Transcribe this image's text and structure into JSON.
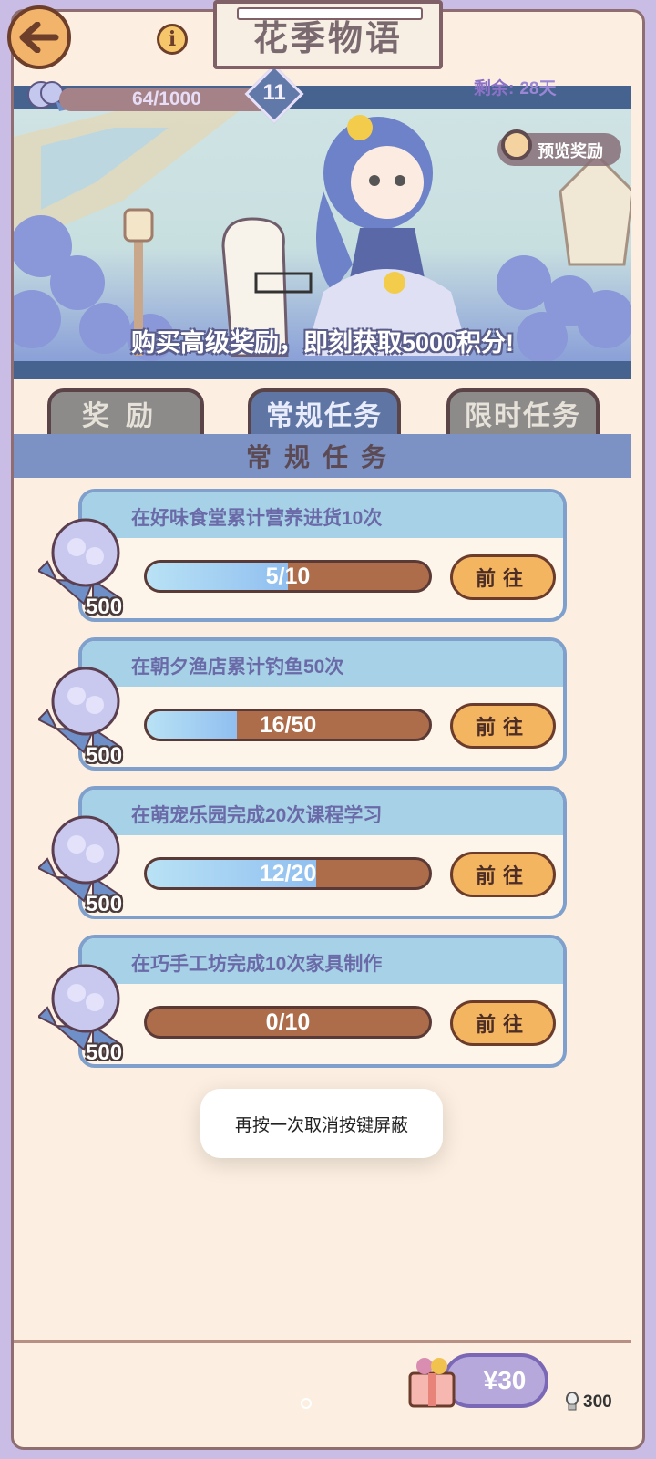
{
  "header": {
    "title": "花季物语",
    "points": "64/1000",
    "level": "11",
    "remaining_label": "剩余:",
    "remaining_value": "28天",
    "preview_label": "预览奖励",
    "promo_text": "购买高级奖励，即刻获取5000积分!"
  },
  "tabs": [
    {
      "label": "奖励",
      "active": false
    },
    {
      "label": "常规任务",
      "active": true
    },
    {
      "label": "限时任务",
      "active": false
    }
  ],
  "section_title": "常规任务",
  "tasks": [
    {
      "title": "在好味食堂累计营养进货10次",
      "progress": "5/10",
      "fraction": 0.5,
      "reward": "500",
      "button": "前往"
    },
    {
      "title": "在朝夕渔店累计钓鱼50次",
      "progress": "16/50",
      "fraction": 0.32,
      "reward": "500",
      "button": "前往"
    },
    {
      "title": "在萌宠乐园完成20次课程学习",
      "progress": "12/20",
      "fraction": 0.6,
      "reward": "500",
      "button": "前往"
    },
    {
      "title": "在巧手工坊完成10次家具制作",
      "progress": "0/10",
      "fraction": 0.0,
      "reward": "500",
      "button": "前往"
    }
  ],
  "toast": "再按一次取消按键屏蔽",
  "footer": {
    "price": "¥30",
    "coins": "300"
  },
  "colors": {
    "accent": "#5f76a5",
    "button": "#f4b561",
    "bar_empty": "#ad6d4b",
    "bar_fill": "#90bff0"
  }
}
